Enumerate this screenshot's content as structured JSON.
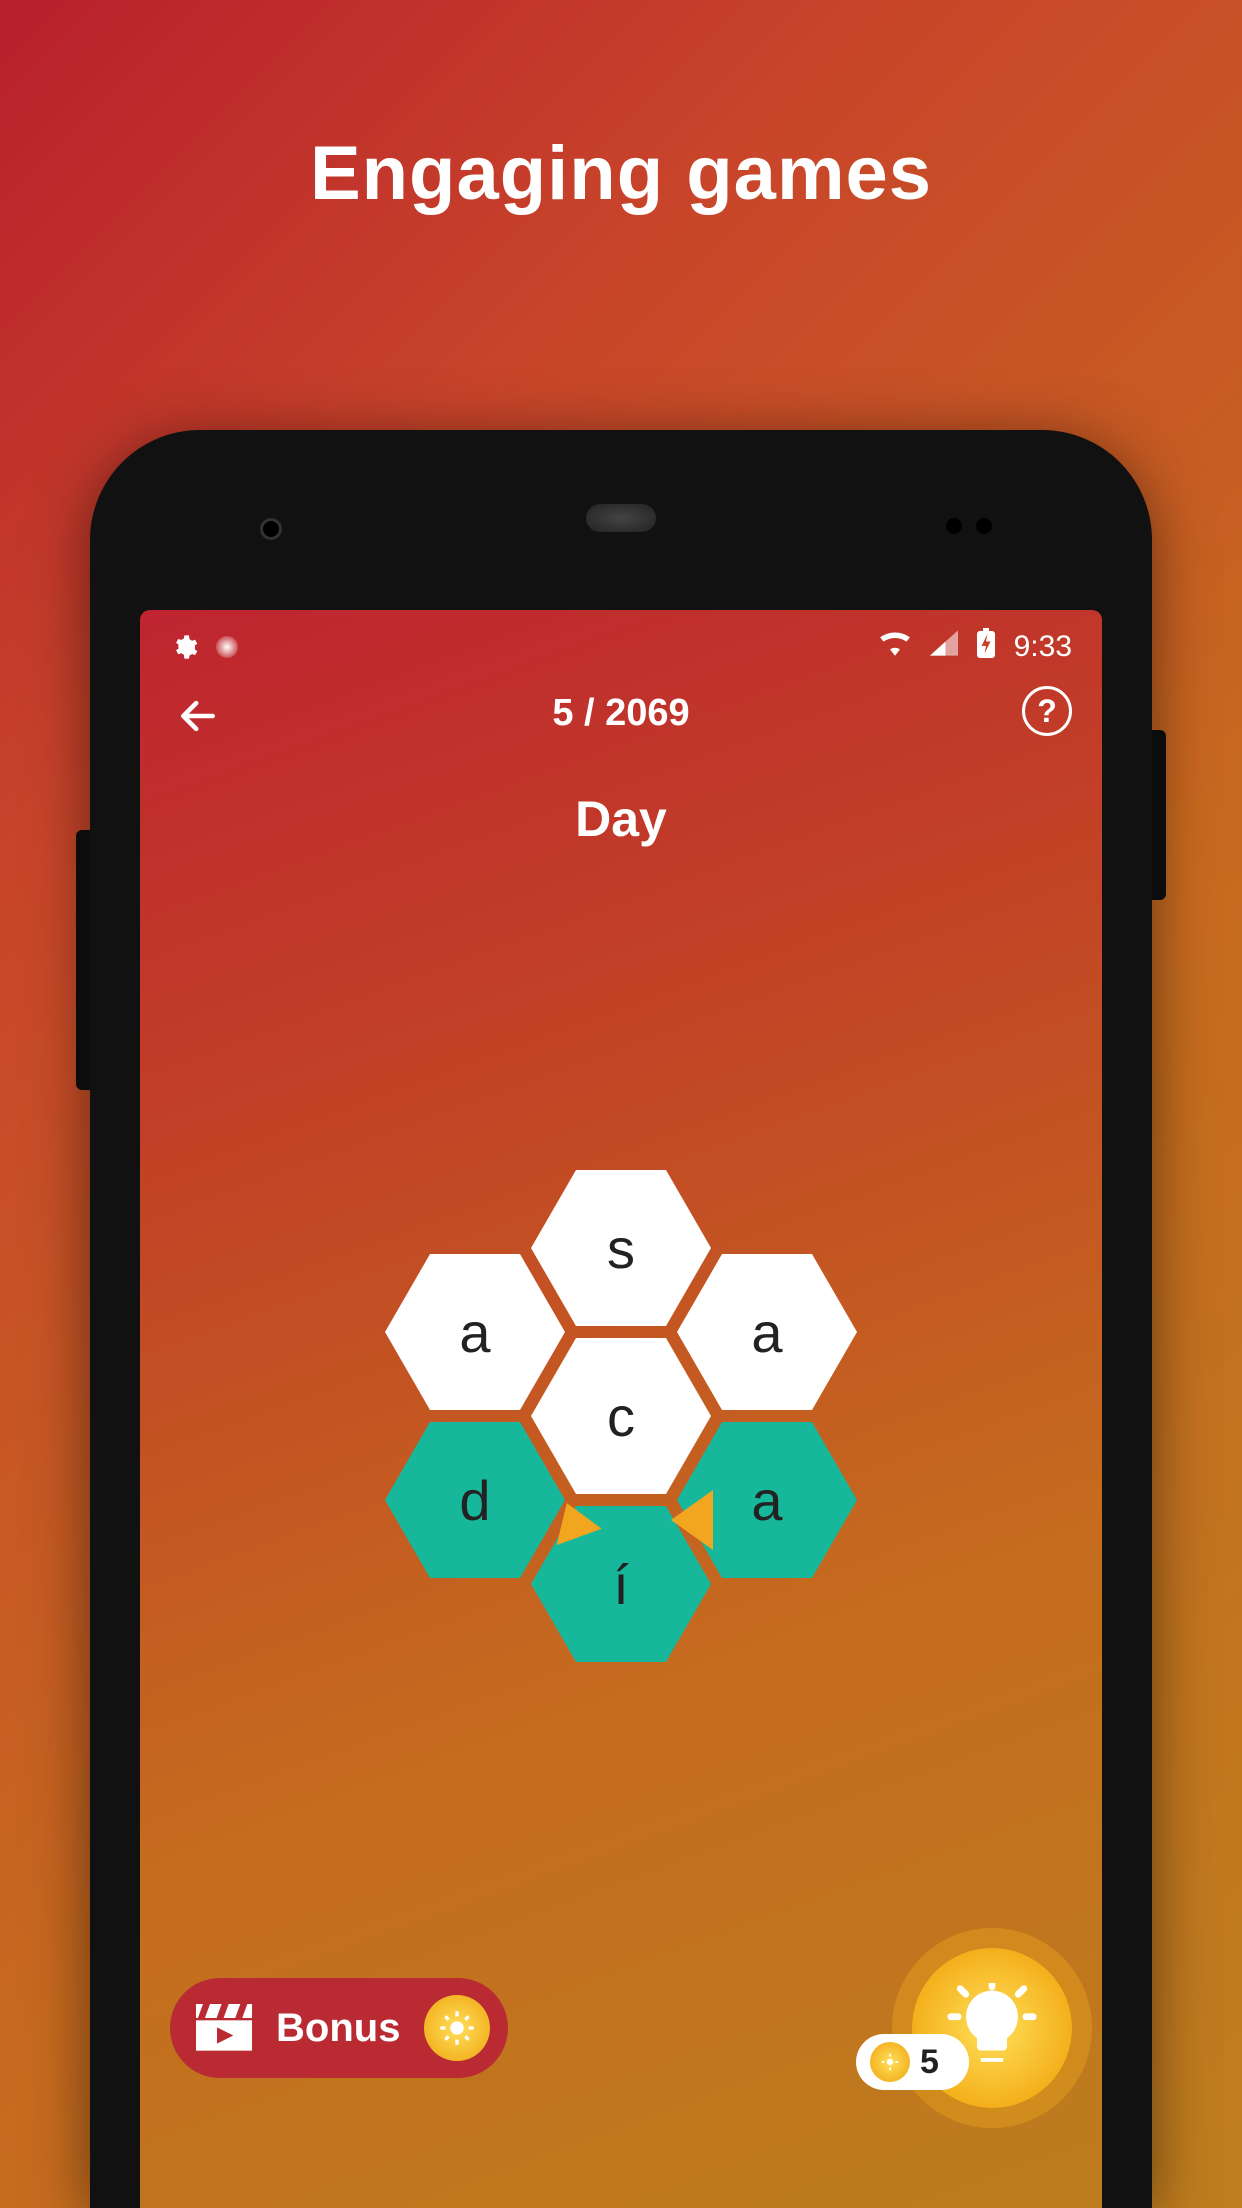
{
  "promo": {
    "heading": "Engaging games"
  },
  "status": {
    "time": "9:33"
  },
  "appbar": {
    "progress": "5 / 2069",
    "help_glyph": "?"
  },
  "word": "Day",
  "hive": {
    "tiles": [
      {
        "pos": "top",
        "letter": "s",
        "color": "white"
      },
      {
        "pos": "upper-left",
        "letter": "a",
        "color": "white"
      },
      {
        "pos": "upper-right",
        "letter": "a",
        "color": "white"
      },
      {
        "pos": "center",
        "letter": "c",
        "color": "white"
      },
      {
        "pos": "lower-left",
        "letter": "d",
        "color": "teal"
      },
      {
        "pos": "lower-right",
        "letter": "a",
        "color": "teal"
      },
      {
        "pos": "bottom",
        "letter": "í",
        "color": "teal"
      }
    ]
  },
  "bonus": {
    "label": "Bonus"
  },
  "hints": {
    "count": "5"
  }
}
